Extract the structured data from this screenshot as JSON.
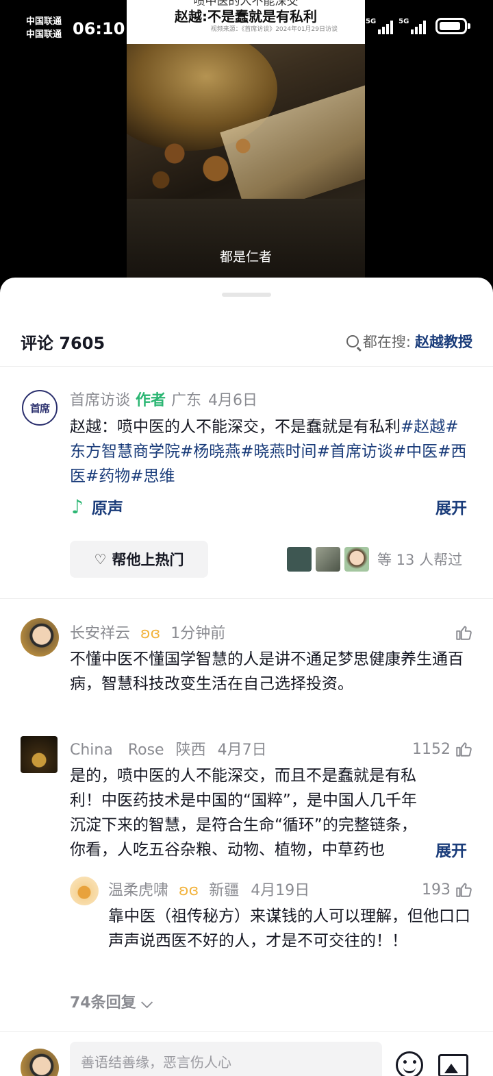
{
  "status_bar": {
    "carrier_1": "中国联通",
    "carrier_2": "中国联通",
    "time": "06:10",
    "net_1": "5G",
    "net_2": "5G"
  },
  "video": {
    "title_line_1": "喷中医的人不能深交",
    "title_line_2": "赵越:不是蠢就是有私利",
    "title_line_3": "视频来源：《首席访谈》2024年01月29日访谈",
    "caption": "都是仁者"
  },
  "header": {
    "comment_count": "评论 7605",
    "hot_search_prefix": "都在搜:",
    "hot_search_term": "赵越教授"
  },
  "author_comment": {
    "avatar_text": "首席",
    "name": "首席访谈",
    "tag": "作者",
    "location": "广东",
    "date": "4月6日",
    "text_plain": "赵越：喷中医的人不能深交，不是蠢就是有私利",
    "hashtags": [
      "#赵越",
      "#东方智慧商学院",
      "#杨晓燕",
      "#晓燕时间",
      "#首席访谈",
      "#中医",
      "#西医",
      "#药物",
      "#思维"
    ],
    "sound_label": "原声",
    "expand_label": "展开",
    "boost_label": "帮他上热门",
    "helpers_label": "等 13 人帮过"
  },
  "comments": [
    {
      "name": "长安祥云",
      "time": "1分钟前",
      "text": "不懂中医不懂国学智慧的人是讲不通足梦思健康养生通百病，智慧科技改变生活在自己选择投资。",
      "likes": ""
    },
    {
      "name": "China　Rose",
      "location": "陕西",
      "date": "4月7日",
      "likes": "1152",
      "text_line_1": "是的，喷中医的人不能深交，而且不是蠢就是有私",
      "text_line_2": "利！中医药技术是中国的“国粹”，是中国人几千年",
      "text_line_3": "沉淀下来的智慧，是符合生命“循环”的完整链条，",
      "text_line_4": "你看，人吃五谷杂粮、动物、植物，中草药也",
      "expand_label": "展开"
    }
  ],
  "reply": {
    "name": "温柔虎啸",
    "location": "新疆",
    "date": "4月19日",
    "likes": "193",
    "text": "靠中医（祖传秘方）来谋钱的人可以理解，但他口口声声说西医不好的人，才是不可交往的！！"
  },
  "replies_link": "74条回复 ⌵",
  "input": {
    "placeholder": "善语结善缘，恶言伤人心"
  }
}
